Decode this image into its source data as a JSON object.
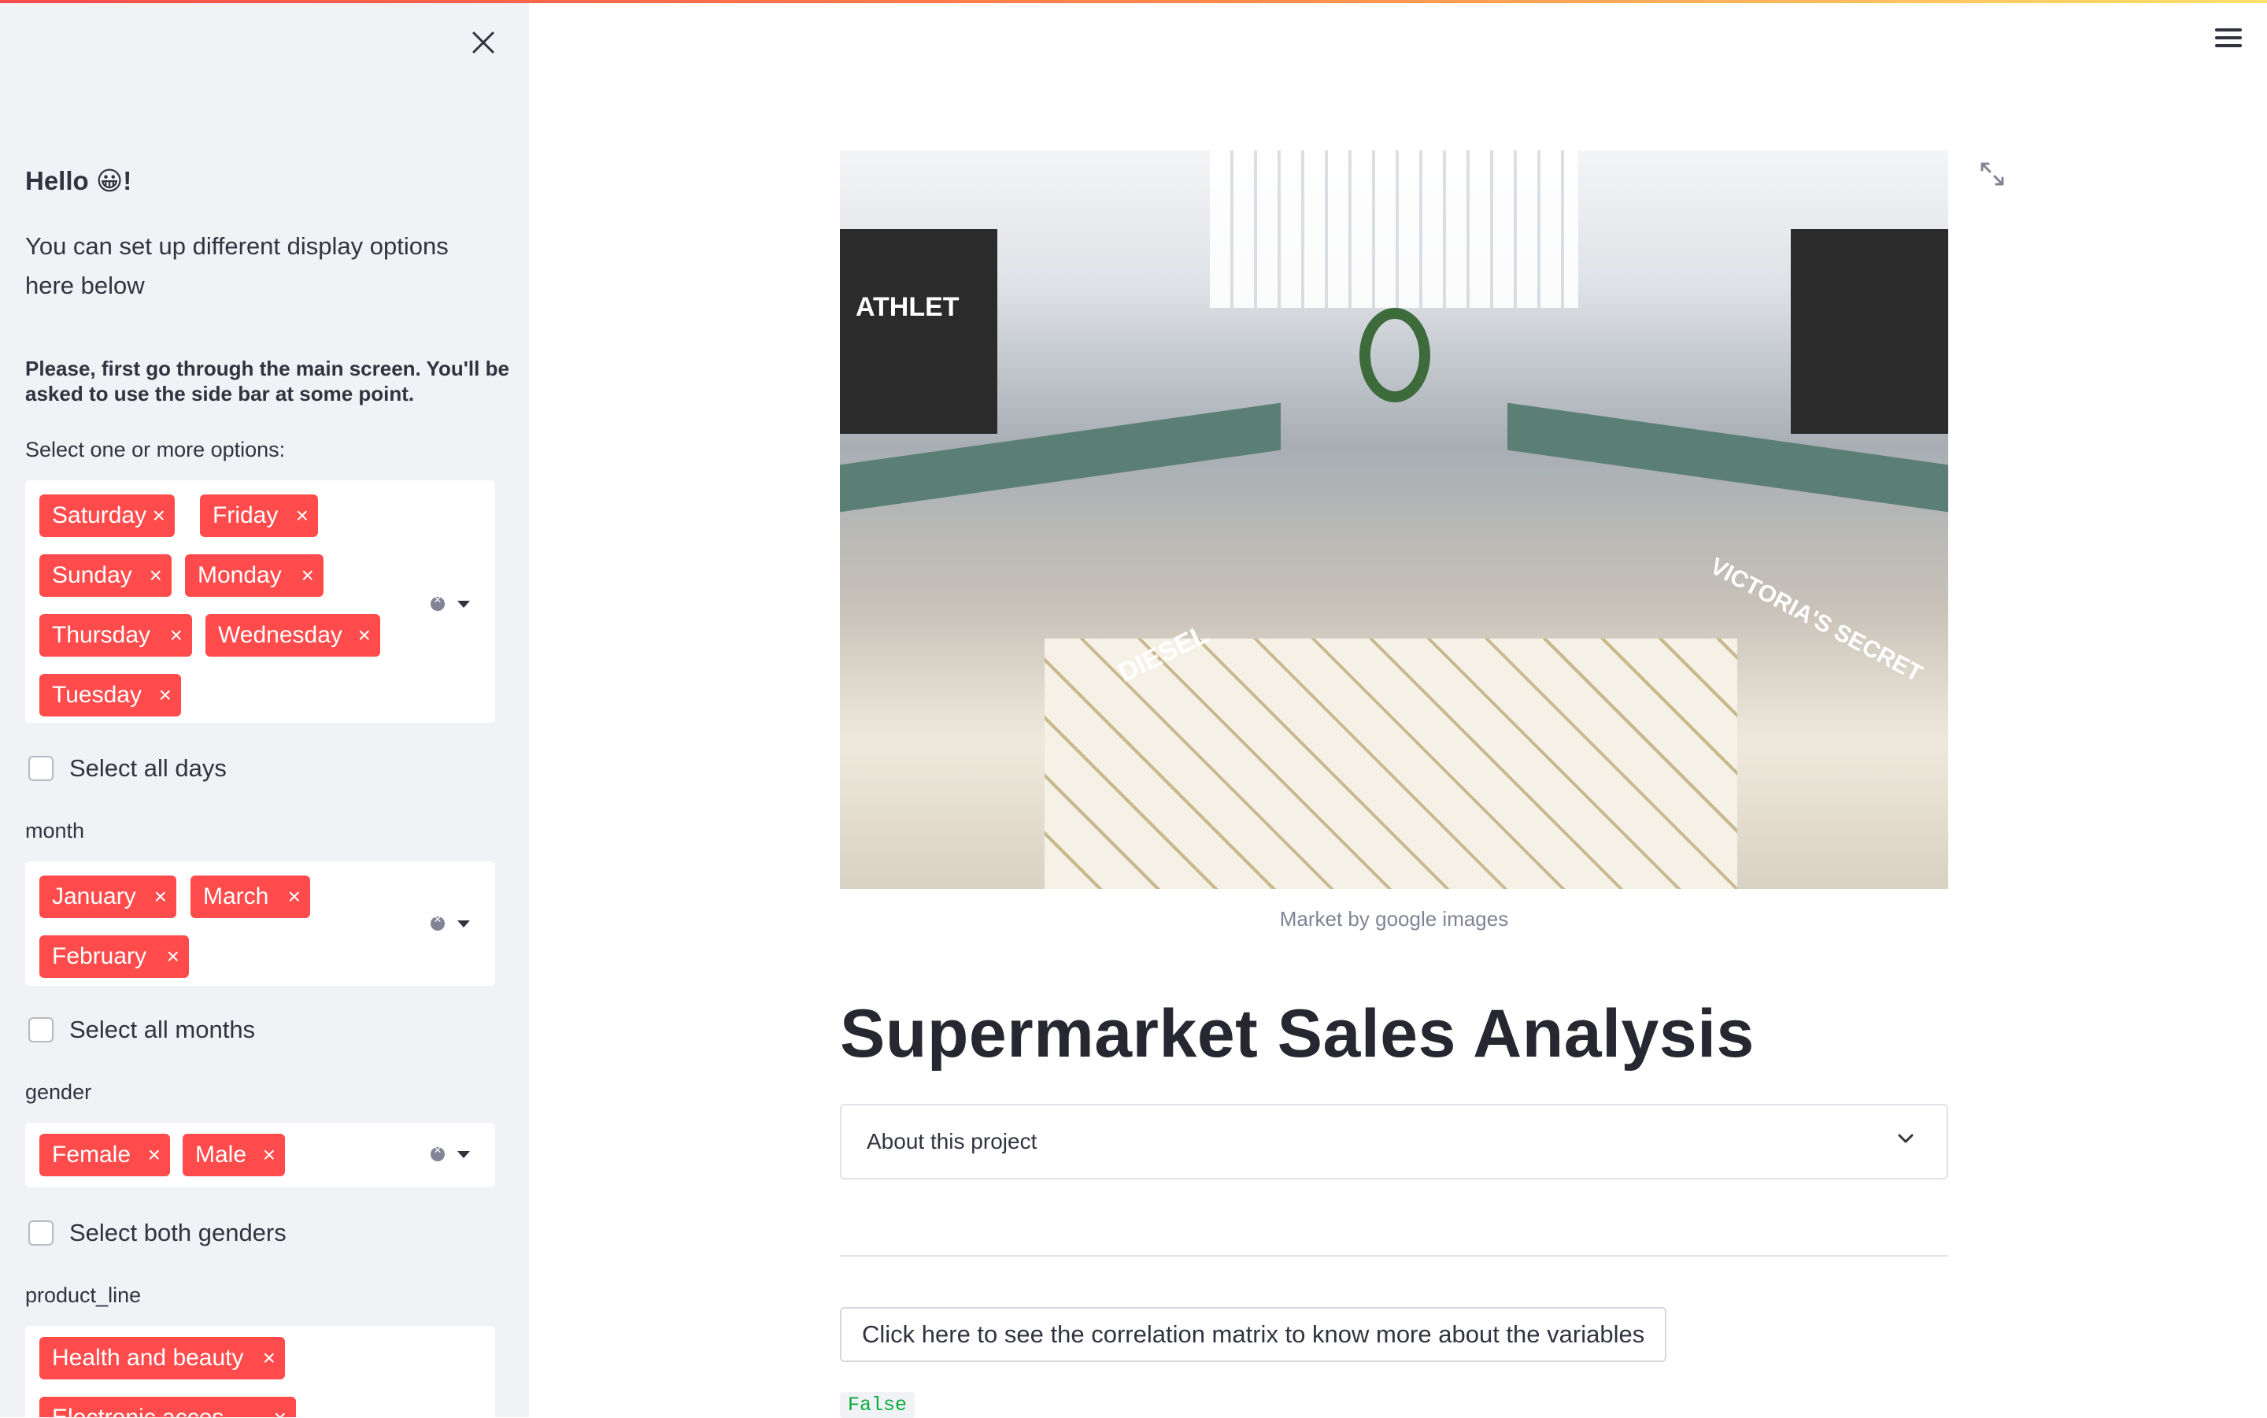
{
  "sidebar": {
    "hello": "Hello 😀!",
    "description": "You can set up different display options here below",
    "note": "Please, first go through the main screen. You'll be asked to use the side bar at some point.",
    "days": {
      "label": "Select one or more options:",
      "chips": [
        "Saturday",
        "Friday",
        "Sunday",
        "Monday",
        "Thursday",
        "Wednesday",
        "Tuesday"
      ],
      "checkbox_label": "Select all days",
      "checked": false
    },
    "months": {
      "label": "month",
      "chips": [
        "January",
        "March",
        "February"
      ],
      "checkbox_label": "Select all months",
      "checked": false
    },
    "gender": {
      "label": "gender",
      "chips": [
        "Female",
        "Male"
      ],
      "checkbox_label": "Select both genders",
      "checked": false
    },
    "product_line": {
      "label": "product_line",
      "chips": [
        "Health and beauty",
        "Electronic acces..."
      ]
    },
    "chip_remove_glyph": "×"
  },
  "main": {
    "image": {
      "caption": "Market by google images",
      "signs": [
        "ATHLET",
        "DIESEL",
        "VICTORIA'S SECRET"
      ]
    },
    "title": "Supermarket Sales Analysis",
    "expander_label": "About this project",
    "correlation_button": "Click here to see the correlation matrix to know more about the variables",
    "checkbox_value": "False"
  },
  "colors": {
    "accent": "#ff4b4b",
    "sidebar_bg": "#f0f2f6",
    "text": "#31333f"
  }
}
